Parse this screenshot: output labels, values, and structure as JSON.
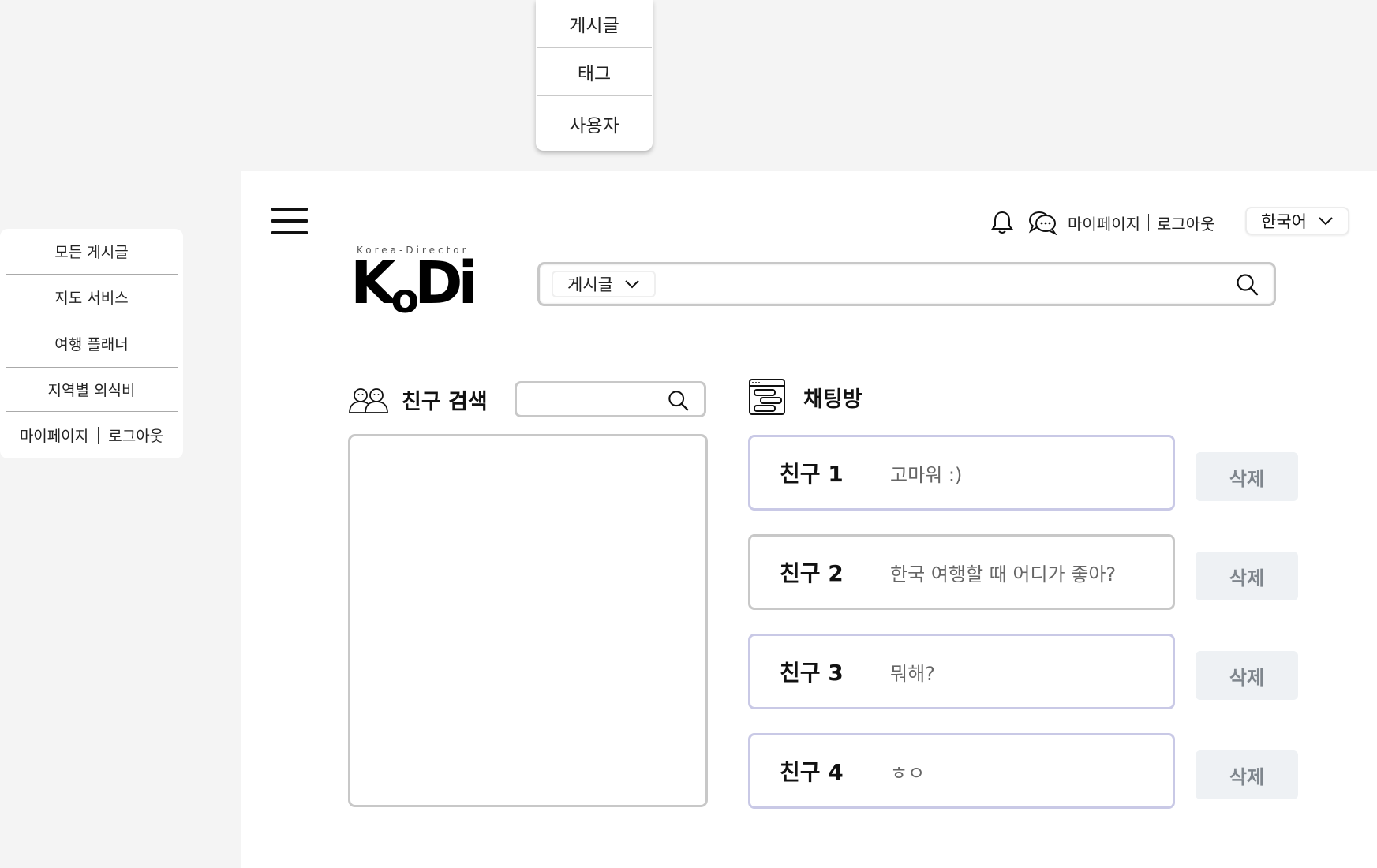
{
  "search_type_dropdown": {
    "options": [
      "게시글",
      "태그",
      "사용자"
    ]
  },
  "side_menu": {
    "items": [
      "모든 게시글",
      "지도 서비스",
      "여행 플래너",
      "지역별 외식비"
    ],
    "mypage": "마이페이지",
    "logout": "로그아웃"
  },
  "header": {
    "bell_icon": "bell-icon",
    "chat_icon": "chat-bubbles-icon",
    "mypage": "마이페이지",
    "logout": "로그아웃",
    "language": "한국어"
  },
  "logo": {
    "tagline": "Korea-Director",
    "mark_k": "K",
    "mark_o": "o",
    "mark_di": "Di"
  },
  "search": {
    "scope": "게시글"
  },
  "friend_search": {
    "title": "친구 검색"
  },
  "chat_rooms": {
    "title": "채팅방",
    "rooms": [
      {
        "name": "친구 1",
        "last_message": "고마워 :)",
        "delete_label": "삭제"
      },
      {
        "name": "친구 2",
        "last_message": "한국 여행할 때 어디가 좋아?",
        "delete_label": "삭제"
      },
      {
        "name": "친구 3",
        "last_message": "뭐해?",
        "delete_label": "삭제"
      },
      {
        "name": "친구 4",
        "last_message": "ㅎㅇ",
        "delete_label": "삭제"
      }
    ]
  },
  "colors": {
    "page_bg": "#f4f4f4",
    "panel_bg": "#ffffff",
    "delete_bg": "#eef1f4",
    "delete_text": "#7f868d",
    "chat_border": "#c9c9e6"
  }
}
